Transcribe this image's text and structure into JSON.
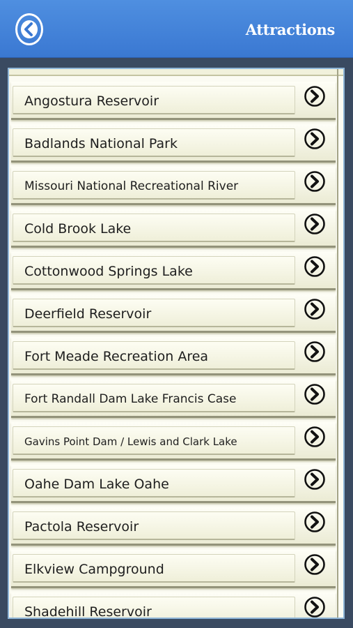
{
  "header": {
    "title": "Attractions",
    "back_icon": "back-arrow-icon"
  },
  "colors": {
    "header": "#4281d8",
    "list_background": "#fbfbf3",
    "text": "#1e1e1e"
  },
  "list": {
    "items": [
      {
        "label": "Angostura Reservoir",
        "font_size": 19
      },
      {
        "label": "Badlands National Park",
        "font_size": 19
      },
      {
        "label": "Missouri National Recreational River",
        "font_size": 17
      },
      {
        "label": "Cold Brook Lake",
        "font_size": 19
      },
      {
        "label": "Cottonwood Springs Lake",
        "font_size": 19
      },
      {
        "label": "Deerfield Reservoir",
        "font_size": 19
      },
      {
        "label": "Fort Meade Recreation Area",
        "font_size": 19
      },
      {
        "label": "Fort Randall Dam Lake Francis Case",
        "font_size": 17
      },
      {
        "label": "Gavins Point Dam / Lewis and Clark Lake",
        "font_size": 15
      },
      {
        "label": "Oahe Dam Lake Oahe",
        "font_size": 19
      },
      {
        "label": "Pactola Reservoir",
        "font_size": 19
      },
      {
        "label": "Elkview Campground",
        "font_size": 19
      },
      {
        "label": "Shadehill Reservoir",
        "font_size": 19
      }
    ],
    "row_icon": "chevron-right-circle-icon"
  }
}
